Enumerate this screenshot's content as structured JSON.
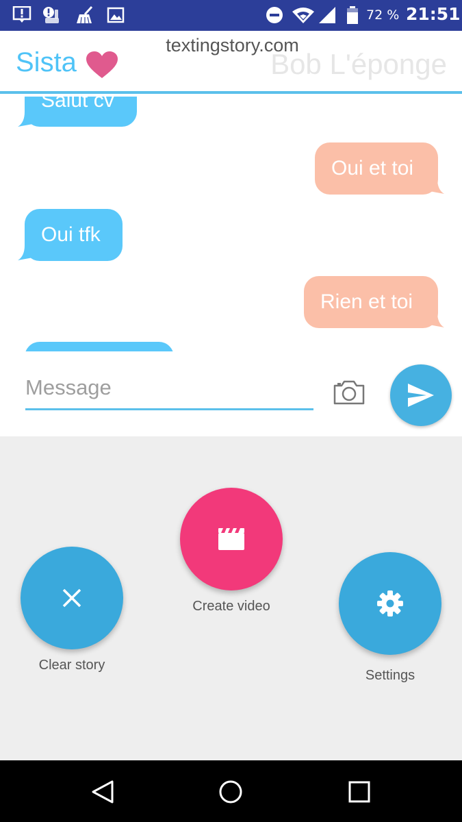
{
  "status_bar": {
    "battery_percent": "72 %",
    "time": "21:51",
    "icons": [
      "notification-alert-icon",
      "app-alert-icon",
      "cleaner-icon",
      "image-icon",
      "do-not-disturb-icon",
      "wifi-icon",
      "cell-signal-icon",
      "battery-icon"
    ]
  },
  "header": {
    "contact_left": "Sista",
    "contact_right": "Bob L'éponge",
    "watermark": "textingstory.com",
    "heart_color": "#e05a8e",
    "divider_color": "#5bc0eb"
  },
  "messages": [
    {
      "side": "left",
      "text": "Salut cv"
    },
    {
      "side": "right",
      "text": "Oui et toi"
    },
    {
      "side": "left",
      "text": "Oui tfk"
    },
    {
      "side": "right",
      "text": "Rien et toi"
    },
    {
      "side": "left",
      "text": ""
    }
  ],
  "composer": {
    "placeholder": "Message",
    "send_icon": "send-icon",
    "camera_icon": "camera-icon"
  },
  "actions": {
    "clear_story": "Clear story",
    "create_video": "Create video",
    "settings": "Settings",
    "primary_color": "#3aa9dc",
    "accent_color": "#f2397a"
  },
  "colors": {
    "left_bubble": "#5ac8fa",
    "right_bubble": "#fbbfa8",
    "status_bar": "#2c3e99"
  }
}
